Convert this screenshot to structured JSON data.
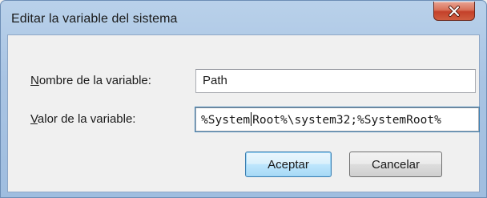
{
  "window": {
    "title": "Editar la variable del sistema"
  },
  "title_bar": {
    "close_icon": "close-x-icon",
    "close_color": "#c4412a"
  },
  "form": {
    "name_label_mnemonic": "N",
    "name_label_rest": "ombre de la variable:",
    "name_value": "Path",
    "value_label_mnemonic": "V",
    "value_label_rest": "alor de la variable:",
    "value_before_caret": "%System",
    "value_after_caret": "Root%\\system32;%SystemRoot%"
  },
  "buttons": {
    "ok_label": "Aceptar",
    "cancel_label": "Cancelar"
  },
  "colors": {
    "accent": "#3c7fb1",
    "frame": "#b9d1ea"
  }
}
